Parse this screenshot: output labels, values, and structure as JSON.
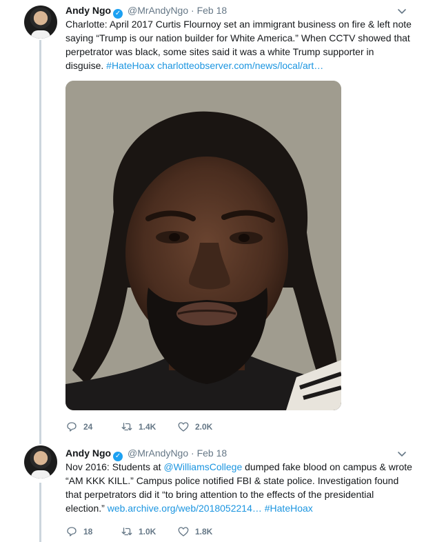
{
  "tweets": [
    {
      "name": "Andy Ngo",
      "handle": "@MrAndyNgo",
      "separator": "·",
      "date": "Feb 18",
      "text_parts": [
        {
          "text": "Charlotte: April 2017 Curtis Flournoy set an immigrant business on fire & left note saying “Trump is our nation builder for White America.” When CCTV showed that perpetrator was black, some sites said it was a white Trump supporter in disguise. ",
          "link": false
        },
        {
          "text": "#HateHoax",
          "link": true
        },
        {
          "text": " ",
          "link": false
        },
        {
          "text": "charlotteobserver.com/news/local/art…",
          "link": true
        }
      ],
      "has_photo": true,
      "replies": "24",
      "retweets": "1.4K",
      "likes": "2.0K"
    },
    {
      "name": "Andy Ngo",
      "handle": "@MrAndyNgo",
      "separator": "·",
      "date": "Feb 18",
      "text_parts": [
        {
          "text": "Nov 2016: Students at ",
          "link": false
        },
        {
          "text": "@WilliamsCollege",
          "link": true
        },
        {
          "text": " dumped fake blood on campus & wrote “AM KKK KILL.” Campus police notified FBI & state police. Investigation found that perpetrators did it “to bring attention to the effects of the presidential election.” ",
          "link": false
        },
        {
          "text": "web.archive.org/web/2018052214…",
          "link": true
        },
        {
          "text": " ",
          "link": false
        },
        {
          "text": "#HateHoax",
          "link": true
        }
      ],
      "has_photo": false,
      "replies": "18",
      "retweets": "1.0K",
      "likes": "1.8K"
    }
  ],
  "icons": {
    "verified": "verified-badge-icon",
    "menu": "chevron-down-icon",
    "reply": "reply-icon",
    "retweet": "retweet-icon",
    "like": "heart-icon"
  },
  "colors": {
    "link": "#1b95e0",
    "muted": "#657786",
    "verified": "#1da1f2",
    "thread_line": "#ccd6dd"
  }
}
